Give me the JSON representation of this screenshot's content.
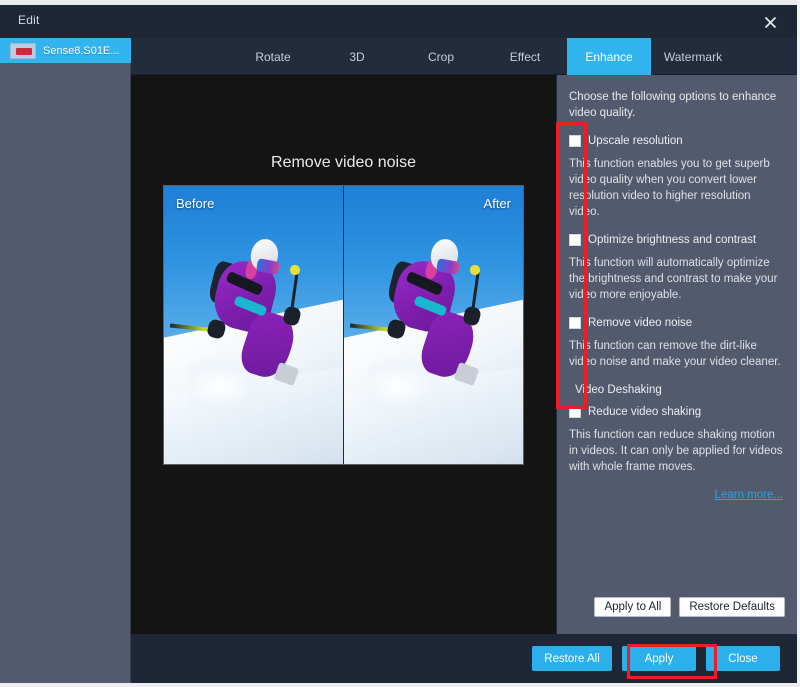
{
  "window": {
    "title": "Edit",
    "close_icon": "close-icon"
  },
  "sidebar": {
    "items": [
      {
        "label": "Sense8.S01E...",
        "thumb_icon": "video-thumbnail-icon"
      }
    ]
  },
  "tabs": [
    {
      "label": "Rotate",
      "active": false
    },
    {
      "label": "3D",
      "active": false
    },
    {
      "label": "Crop",
      "active": false
    },
    {
      "label": "Effect",
      "active": false
    },
    {
      "label": "Enhance",
      "active": true
    },
    {
      "label": "Watermark",
      "active": false
    }
  ],
  "preview": {
    "title": "Remove video noise",
    "before_label": "Before",
    "after_label": "After"
  },
  "panel": {
    "intro": "Choose the following options to enhance video quality.",
    "options": [
      {
        "label": "Upscale resolution",
        "checked": false,
        "description": "This function enables you to get superb video quality when you convert lower resolution video to higher resolution video."
      },
      {
        "label": "Optimize brightness and contrast",
        "checked": false,
        "description": "This function will automatically optimize the brightness and contrast to make your video more enjoyable."
      },
      {
        "label": "Remove video noise",
        "checked": false,
        "description": "This function can remove the dirt-like video noise and make your video cleaner."
      }
    ],
    "group_title": "Video Deshaking",
    "deshake_option": {
      "label": "Reduce video shaking",
      "checked": false,
      "description": "This function can reduce shaking motion in videos. It can only be applied for videos with whole frame moves."
    },
    "learn_more": "Learn more...",
    "apply_to_all": "Apply to All",
    "restore_defaults": "Restore Defaults"
  },
  "bottom_bar": {
    "restore_all": "Restore All",
    "apply": "Apply",
    "close": "Close"
  },
  "colors": {
    "accent_blue": "#2bb0ec",
    "panel_gray": "#545a6d",
    "dark_chrome": "#1e2736",
    "annotation_red": "#ee1c25",
    "link_blue": "#2f9fe0"
  }
}
